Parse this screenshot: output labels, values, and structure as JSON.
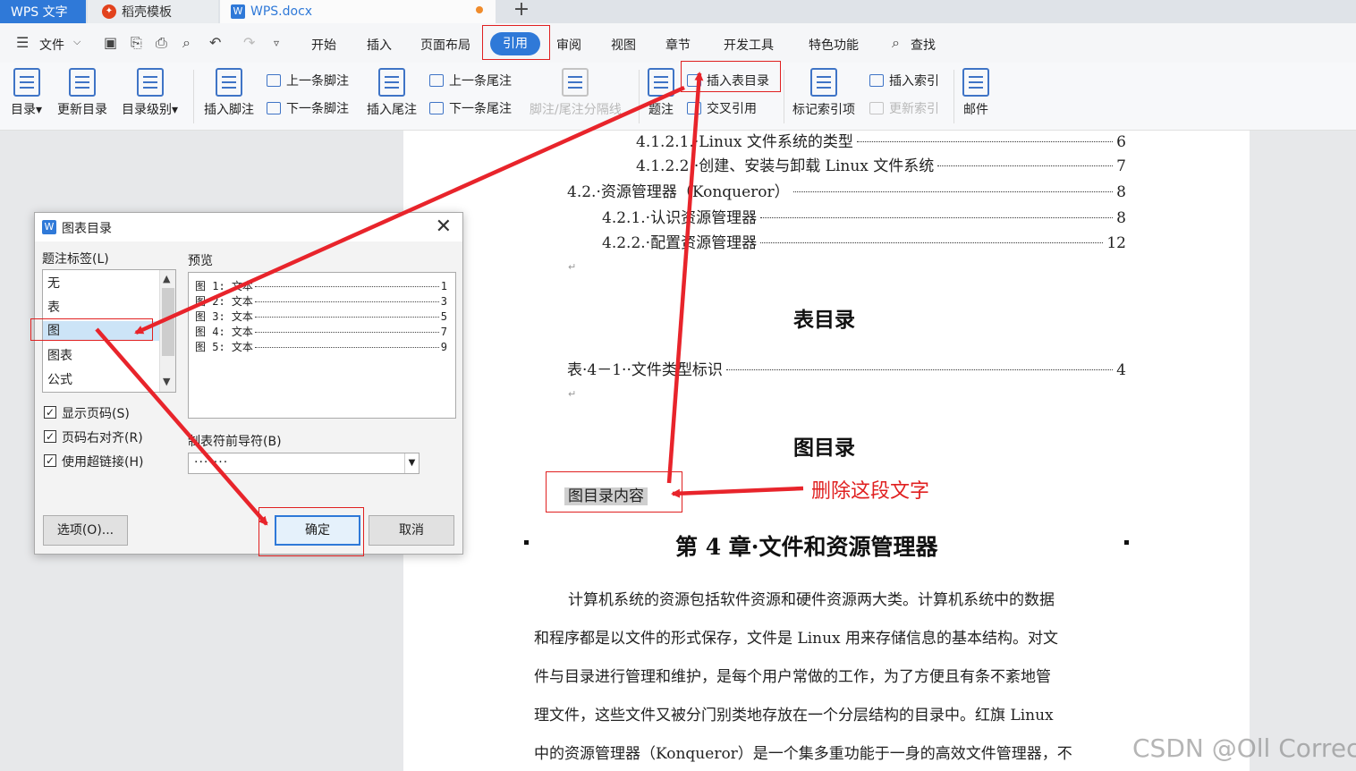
{
  "tabs": {
    "wps": "WPS 文字",
    "daoke": "稻壳模板",
    "doc": "WPS.docx",
    "plus": "+"
  },
  "menu": {
    "file": "文件",
    "items": [
      "开始",
      "插入",
      "页面布局",
      "引用",
      "审阅",
      "视图",
      "章节",
      "开发工具",
      "特色功能",
      "查找"
    ],
    "active": "引用"
  },
  "ribbon": {
    "toc": "目录",
    "update_toc": "更新目录",
    "toc_level": "目录级别",
    "insert_footnote": "插入脚注",
    "prev_footnote": "上一条脚注",
    "next_footnote": "下一条脚注",
    "insert_endnote": "插入尾注",
    "prev_endnote": "上一条尾注",
    "next_endnote": "下一条尾注",
    "separator": "脚注/尾注分隔线",
    "caption": "题注",
    "insert_table_toc": "插入表目录",
    "cross_ref": "交叉引用",
    "mark_index": "标记索引项",
    "insert_index": "插入索引",
    "update_index": "更新索引",
    "mail": "邮件"
  },
  "document": {
    "toc": [
      {
        "text": "4.1.2.1.·Linux 文件系统的类型",
        "page": "6"
      },
      {
        "text": "4.1.2.2.·创建、安装与卸载 Linux 文件系统",
        "page": "7"
      },
      {
        "text": "4.2.·资源管理器（Konqueror）",
        "page": "8"
      },
      {
        "text": "4.2.1.·认识资源管理器",
        "page": "8"
      },
      {
        "text": "4.2.2.·配置资源管理器",
        "page": "12"
      }
    ],
    "table_toc_title": "表目录",
    "table_toc_entry": {
      "text": "表·4－1··文件类型标识",
      "page": "4"
    },
    "figure_toc_title": "图目录",
    "figure_toc_content": "图目录内容",
    "chapter_title": "第 4 章·文件和资源管理器",
    "paragraph": [
      "计算机系统的资源包括软件资源和硬件资源两大类。计算机系统中的数据",
      "和程序都是以文件的形式保存，文件是 Linux 用来存储信息的基本结构。对文",
      "件与目录进行管理和维护，是每个用户常做的工作，为了方便且有条不紊地管",
      "理文件，这些文件又被分门别类地存放在一个分层结构的目录中。红旗 Linux",
      "中的资源管理器（Konqueror）是一个集多重功能于一身的高效文件管理器，不"
    ]
  },
  "dialog": {
    "title": "图表目录",
    "caption_label": "题注标签(L)",
    "caption_items": [
      "无",
      "表",
      "图",
      "图表",
      "公式"
    ],
    "selected": "图",
    "preview_label": "预览",
    "preview_lines": [
      {
        "text": "图 1: 文本",
        "page": "1"
      },
      {
        "text": "图 2: 文本",
        "page": "3"
      },
      {
        "text": "图 3: 文本",
        "page": "5"
      },
      {
        "text": "图 4: 文本",
        "page": "7"
      },
      {
        "text": "图 5: 文本",
        "page": "9"
      }
    ],
    "show_page": "显示页码(S)",
    "align_right": "页码右对齐(R)",
    "hyperlink": "使用超链接(H)",
    "leader_label": "制表符前导符(B)",
    "leader_value": "·······",
    "options": "选项(O)...",
    "ok": "确定",
    "cancel": "取消"
  },
  "annotation": "删除这段文字",
  "watermark": "CSDN @Oll Correct"
}
